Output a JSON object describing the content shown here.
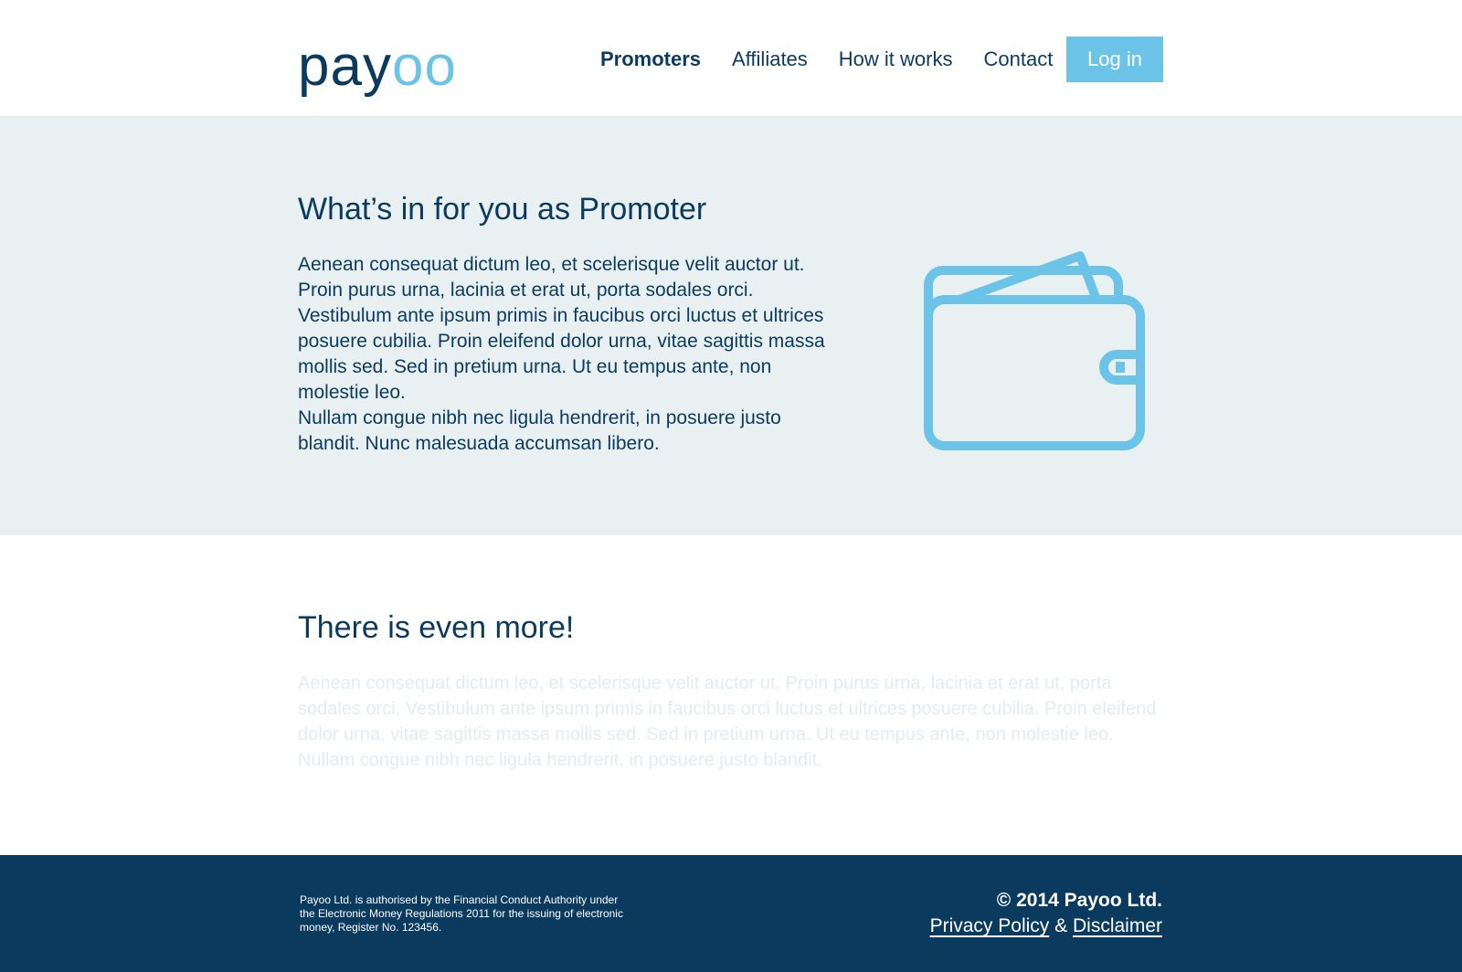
{
  "header": {
    "logo": {
      "primary": "pay",
      "accent": "oo"
    },
    "nav": [
      {
        "label": "Promoters",
        "active": true
      },
      {
        "label": "Affiliates",
        "active": false
      },
      {
        "label": "How it works",
        "active": false
      },
      {
        "label": "Contact",
        "active": false
      }
    ],
    "login_label": "Log in"
  },
  "section_promoter": {
    "title": "What’s in for you as Promoter",
    "paragraph_1": "Aenean consequat dictum leo, et scelerisque velit auctor ut. Proin purus urna, lacinia et erat ut, porta sodales orci. Vestibulum ante ipsum primis in faucibus orci luctus et ultrices posuere cubilia. Proin eleifend dolor urna, vitae sagittis massa mollis sed. Sed in pretium urna. Ut eu tempus ante, non molestie leo.",
    "paragraph_2": "Nullam congue nibh nec ligula hendrerit, in posuere justo blandit. Nunc malesuada accumsan libero.",
    "icon": "wallet-icon"
  },
  "section_more": {
    "title": "There is even more!",
    "paragraph": "Aenean consequat dictum leo, et scelerisque velit auctor ut. Proin purus urna, lacinia et erat ut, porta sodales orci. Vestibulum ante ipsum primis in faucibus orci luctus et ultrices posuere cubilia.  Proin eleifend dolor urna, vitae sagittis massa mollis sed. Sed in pretium urna. Ut eu tempus ante, non molestie leo.  Nullam congue nibh nec ligula hendrerit, in posuere justo blandit."
  },
  "footer": {
    "legal": "Payoo Ltd. is authorised by the Financial Conduct Authority under the Electronic Money Regulations 2011 for the issuing of electronic money, Register No. 123456.",
    "copyright": "© 2014 Payoo Ltd.",
    "privacy_label": "Privacy Policy",
    "separator": "&",
    "disclaimer_label": "Disclaimer"
  },
  "colors": {
    "navy": "#0b3a5f",
    "accent": "#6bc4e8",
    "section_bg": "#e8f0f2",
    "faded_text": "#e2ecef"
  }
}
